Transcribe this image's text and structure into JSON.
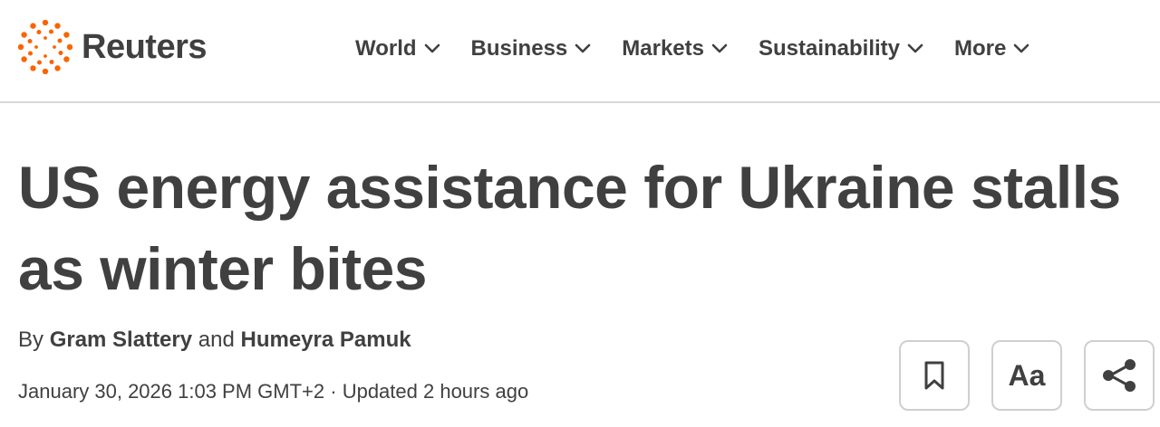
{
  "brand": {
    "name": "Reuters",
    "accent_color": "#fa6400",
    "text_color": "#404040"
  },
  "nav": {
    "items": [
      {
        "label": "World"
      },
      {
        "label": "Business"
      },
      {
        "label": "Markets"
      },
      {
        "label": "Sustainability"
      },
      {
        "label": "More"
      }
    ]
  },
  "article": {
    "headline_line1": "US energy assistance for Ukraine stalls",
    "headline_line2": "as winter bites",
    "byline_prefix": "By ",
    "author1": "Gram Slattery",
    "byline_join": " and ",
    "author2": "Humeyra Pamuk",
    "date": "January 30, 2026 1:03 PM GMT+2",
    "separator": " · ",
    "updated": "Updated 2 hours ago"
  },
  "actions": {
    "bookmark_icon": "bookmark-icon",
    "text_size_label": "Aa",
    "share_icon": "share-icon"
  }
}
